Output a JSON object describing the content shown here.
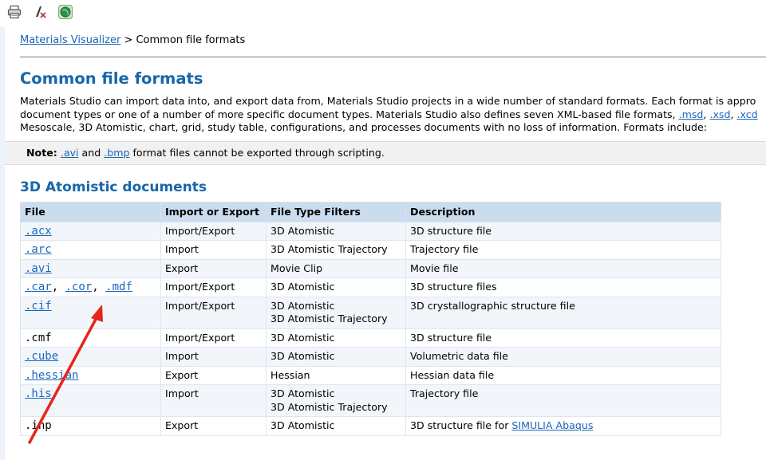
{
  "toolbar": {
    "items": [
      {
        "icon": "printer-icon"
      },
      {
        "icon": "clear-highlight-icon"
      },
      {
        "icon": "globe-icon"
      }
    ]
  },
  "breadcrumb": {
    "link": "Materials Visualizer",
    "separator": " > ",
    "current": "Common file formats"
  },
  "title": "Common file formats",
  "intro": {
    "line1": "Materials Studio can import data into, and export data from, Materials Studio projects in a wide number of standard formats. Each format is appro",
    "line2_pre": "document types or one of a number of more specific document types. Materials Studio also defines seven XML-based file formats, ",
    "links": [
      ".msd",
      ".xsd",
      ".xcd"
    ],
    "line3": "Mesoscale, 3D Atomistic, chart, grid, study table, configurations, and processes documents with no loss of information. Formats include:"
  },
  "note": {
    "label": "Note:",
    "link1": ".avi",
    "and": " and ",
    "link2": ".bmp",
    "text": " format files cannot be exported through scripting."
  },
  "section_title": "3D Atomistic documents",
  "table": {
    "headers": [
      "File",
      "Import or Export",
      "File Type Filters",
      "Description"
    ],
    "rows": [
      {
        "files": [
          ".acx"
        ],
        "linked": true,
        "io": "Import/Export",
        "filters": [
          "3D Atomistic"
        ],
        "desc": "3D structure file"
      },
      {
        "files": [
          ".arc"
        ],
        "linked": true,
        "io": "Import",
        "filters": [
          "3D Atomistic Trajectory"
        ],
        "desc": "Trajectory file"
      },
      {
        "files": [
          ".avi"
        ],
        "linked": true,
        "io": "Export",
        "filters": [
          "Movie Clip"
        ],
        "desc": "Movie file"
      },
      {
        "files": [
          ".car",
          ".cor",
          ".mdf"
        ],
        "linked": true,
        "io": "Import/Export",
        "filters": [
          "3D Atomistic"
        ],
        "desc": "3D structure files"
      },
      {
        "files": [
          ".cif"
        ],
        "linked": true,
        "io": "Import/Export",
        "filters": [
          "3D Atomistic",
          "3D Atomistic Trajectory"
        ],
        "desc": "3D crystallographic structure file"
      },
      {
        "files": [
          ".cmf"
        ],
        "linked": false,
        "io": "Import/Export",
        "filters": [
          "3D Atomistic"
        ],
        "desc": "3D structure file"
      },
      {
        "files": [
          ".cube"
        ],
        "linked": true,
        "io": "Import",
        "filters": [
          "3D Atomistic"
        ],
        "desc": "Volumetric data file"
      },
      {
        "files": [
          ".hessian"
        ],
        "linked": true,
        "io": "Export",
        "filters": [
          "Hessian"
        ],
        "desc": "Hessian data file"
      },
      {
        "files": [
          ".his"
        ],
        "linked": true,
        "io": "Import",
        "filters": [
          "3D Atomistic",
          "3D Atomistic Trajectory"
        ],
        "desc": "Trajectory file"
      },
      {
        "files": [
          ".inp"
        ],
        "linked": false,
        "io": "Export",
        "filters": [
          "3D Atomistic"
        ],
        "desc": "3D structure file for ",
        "desc_link": "SIMULIA Abaqus"
      }
    ]
  },
  "colors": {
    "heading": "#1766aa",
    "link": "#1a66b8",
    "table_header": "#cbdcee",
    "annotation_arrow": "#e8251c"
  }
}
